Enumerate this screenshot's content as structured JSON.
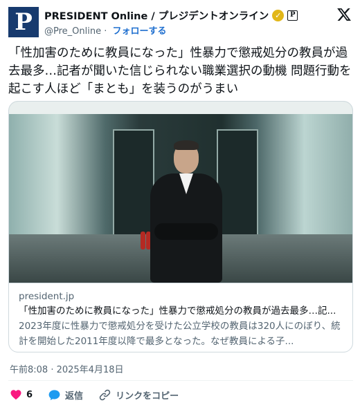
{
  "header": {
    "avatar_letter": "P",
    "display_name": "PRESIDENT Online / プレジデントオンライン",
    "verified_icon": "gold-check",
    "affiliate_badge": "P",
    "handle": "@Pre_Online",
    "separator": "·",
    "follow_label": "フォローする",
    "brand_color": "#173a6e",
    "follow_color": "#1d6ecf"
  },
  "tweet": {
    "text": "「性加害のために教員になった」性暴力で懲戒処分の教員が過去最多…記者が聞いた信じられない職業選択の動機 問題行動を起こす人ほど「まとも」を装うのがうまい"
  },
  "card": {
    "image_alt": "man in dark suit standing arms crossed in corridor",
    "domain": "president.jp",
    "title": "「性加害のために教員になった」性暴力で懲戒処分の教員が過去最多…記...",
    "description": "2023年度に性暴力で懲戒処分を受けた公立学校の教員は320人にのぼり、統計を開始した2011年度以降で最多となった。なぜ教員による子..."
  },
  "timestamp": "午前8:08 · 2025年4月18日",
  "actions": {
    "like_count": "6",
    "like_color": "#f91880",
    "reply_label": "返信",
    "reply_color": "#1d9bf0",
    "copy_link_label": "リンクをコピー"
  }
}
